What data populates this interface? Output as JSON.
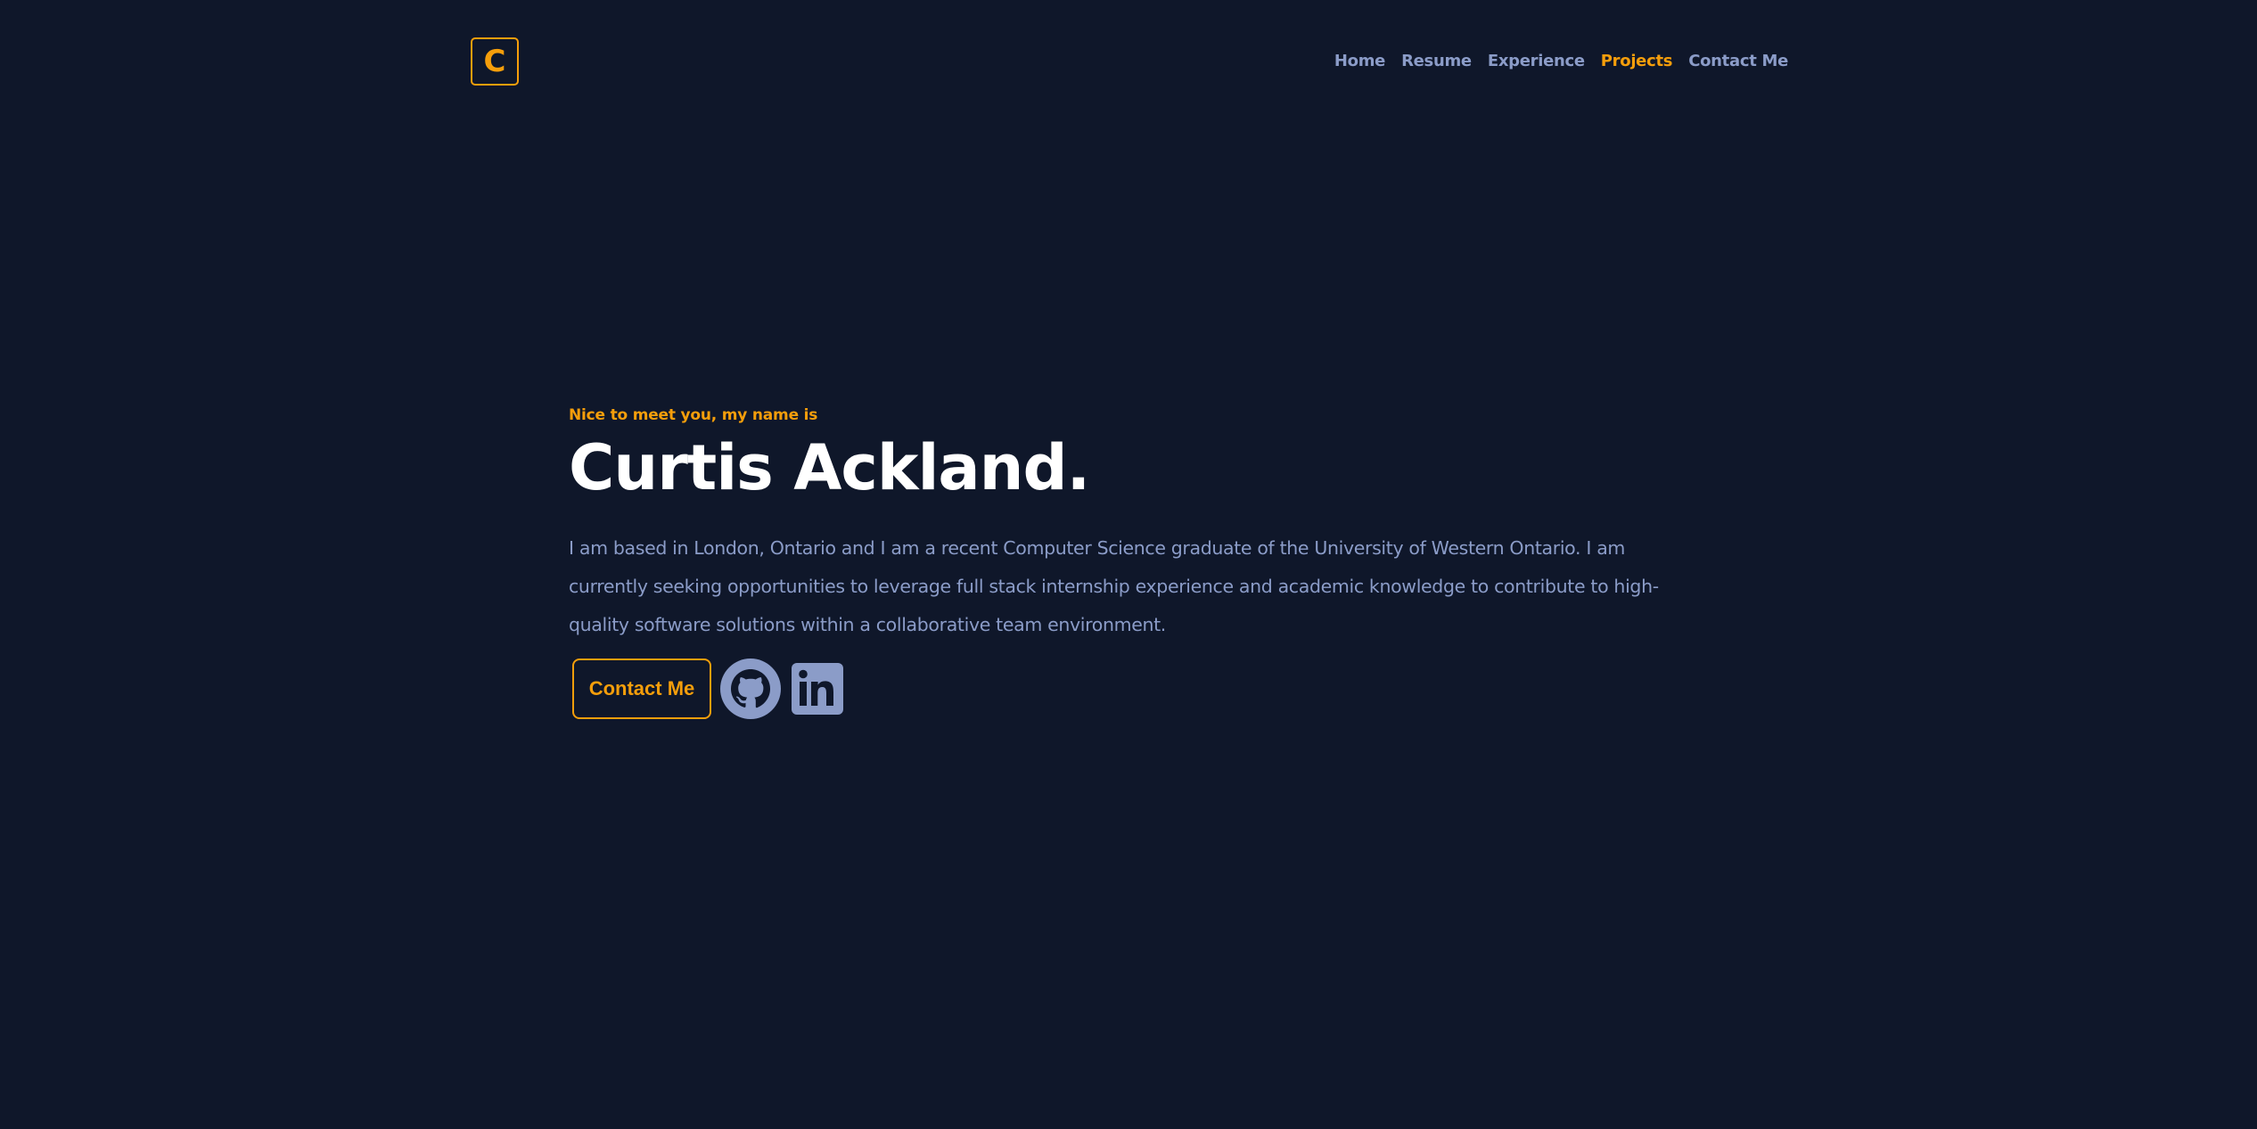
{
  "header": {
    "logo_letter": "C",
    "nav": [
      {
        "label": "Home"
      },
      {
        "label": "Resume"
      },
      {
        "label": "Experience"
      },
      {
        "label": "Projects",
        "active": true
      },
      {
        "label": "Contact Me"
      }
    ]
  },
  "hero": {
    "greeting": "Nice to meet you, my name is",
    "name": "Curtis Ackland.",
    "bio": "I am based in London, Ontario and I am a recent Computer Science graduate of the University of Western Ontario. I am currently seeking opportunities to leverage full stack internship experience and academic knowledge to contribute to high-quality software solutions within a collaborative team environment.",
    "contact_button": "Contact Me",
    "socials": [
      {
        "icon": "github-icon"
      },
      {
        "icon": "linkedin-icon"
      }
    ]
  },
  "colors": {
    "background": "#0f172a",
    "accent": "#f59e0b",
    "muted_text": "#8b9cc8",
    "heading": "#ffffff"
  }
}
